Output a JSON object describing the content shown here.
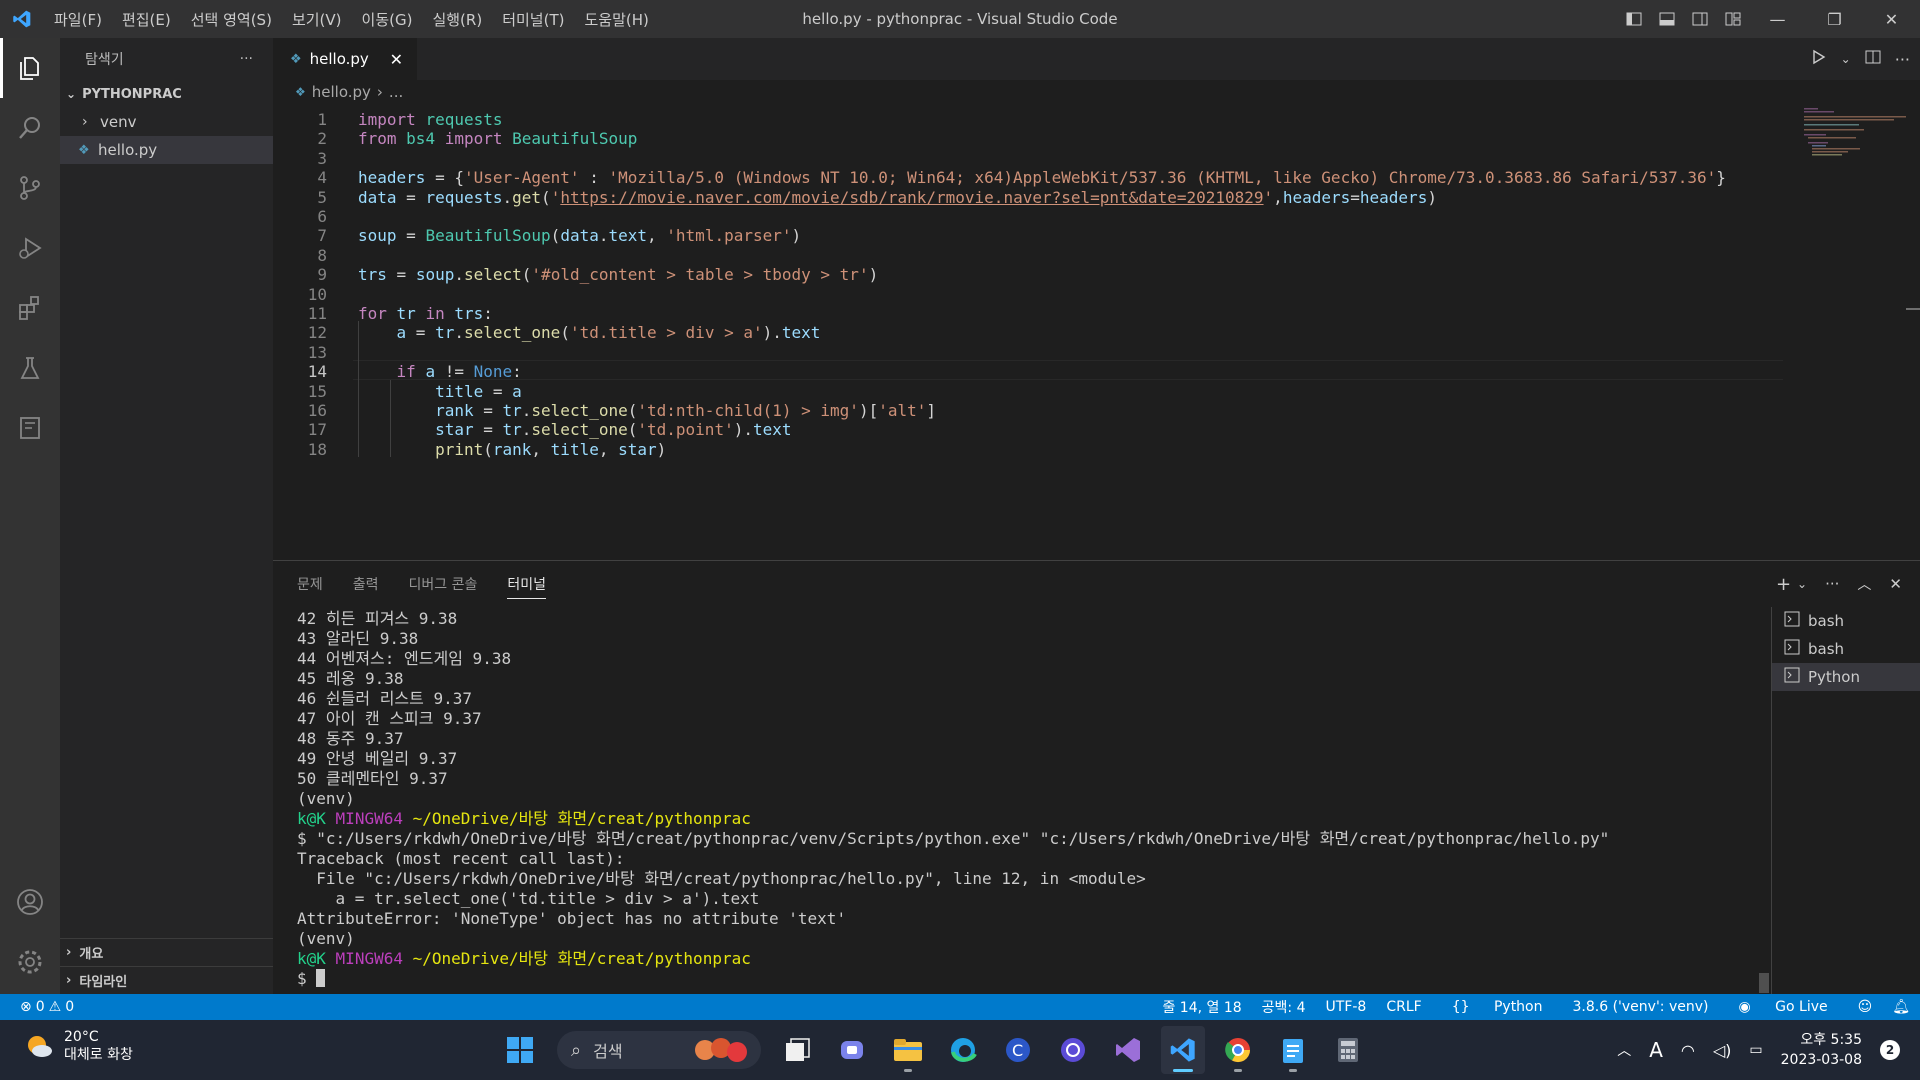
{
  "titlebar": {
    "menu": [
      "파일(F)",
      "편집(E)",
      "선택 영역(S)",
      "보기(V)",
      "이동(G)",
      "실행(R)",
      "터미널(T)",
      "도움말(H)"
    ],
    "window_title": "hello.py - pythonprac - Visual Studio Code"
  },
  "sidebar": {
    "header": "탐색기",
    "more": "···",
    "folder": "PYTHONPRAC",
    "items": [
      "venv",
      "hello.py"
    ],
    "bottom": [
      "개요",
      "타임라인"
    ]
  },
  "editor": {
    "tab_label": "hello.py",
    "breadcrumb": [
      "hello.py",
      "..."
    ],
    "current_line": 14,
    "lines": [
      {
        "n": "1",
        "tokens": [
          [
            "kw",
            "import"
          ],
          [
            "op",
            " "
          ],
          [
            "cl",
            "requests"
          ]
        ]
      },
      {
        "n": "2",
        "tokens": [
          [
            "kw",
            "from"
          ],
          [
            "op",
            " "
          ],
          [
            "cl",
            "bs4"
          ],
          [
            "op",
            " "
          ],
          [
            "kw",
            "import"
          ],
          [
            "op",
            " "
          ],
          [
            "cl",
            "BeautifulSoup"
          ]
        ]
      },
      {
        "n": "3",
        "tokens": []
      },
      {
        "n": "4",
        "tokens": [
          [
            "va",
            "headers"
          ],
          [
            "op",
            " = {"
          ],
          [
            "st",
            "'User-Agent'"
          ],
          [
            "op",
            " : "
          ],
          [
            "st",
            "'Mozilla/5.0 (Windows NT 10.0; Win64; x64)AppleWebKit/537.36 (KHTML, like Gecko) Chrome/73.0.3683.86 Safari/537.36'"
          ],
          [
            "op",
            "}"
          ]
        ]
      },
      {
        "n": "5",
        "tokens": [
          [
            "va",
            "data"
          ],
          [
            "op",
            " = "
          ],
          [
            "va",
            "requests"
          ],
          [
            "op",
            "."
          ],
          [
            "fn",
            "get"
          ],
          [
            "op",
            "("
          ],
          [
            "st",
            "'"
          ],
          [
            "url",
            "https://movie.naver.com/movie/sdb/rank/rmovie.naver?sel=pnt&date=20210829"
          ],
          [
            "st",
            "'"
          ],
          [
            "op",
            ","
          ],
          [
            "va",
            "headers"
          ],
          [
            "op",
            "="
          ],
          [
            "va",
            "headers"
          ],
          [
            "op",
            ")"
          ]
        ]
      },
      {
        "n": "6",
        "tokens": []
      },
      {
        "n": "7",
        "tokens": [
          [
            "va",
            "soup"
          ],
          [
            "op",
            " = "
          ],
          [
            "cl",
            "BeautifulSoup"
          ],
          [
            "op",
            "("
          ],
          [
            "va",
            "data"
          ],
          [
            "op",
            "."
          ],
          [
            "va",
            "text"
          ],
          [
            "op",
            ", "
          ],
          [
            "st",
            "'html.parser'"
          ],
          [
            "op",
            ")"
          ]
        ]
      },
      {
        "n": "8",
        "tokens": []
      },
      {
        "n": "9",
        "tokens": [
          [
            "va",
            "trs"
          ],
          [
            "op",
            " = "
          ],
          [
            "va",
            "soup"
          ],
          [
            "op",
            "."
          ],
          [
            "fn",
            "select"
          ],
          [
            "op",
            "("
          ],
          [
            "st",
            "'#old_content > table > tbody > tr'"
          ],
          [
            "op",
            ")"
          ]
        ]
      },
      {
        "n": "10",
        "tokens": []
      },
      {
        "n": "11",
        "tokens": [
          [
            "kw",
            "for"
          ],
          [
            "op",
            " "
          ],
          [
            "va",
            "tr"
          ],
          [
            "op",
            " "
          ],
          [
            "kw",
            "in"
          ],
          [
            "op",
            " "
          ],
          [
            "va",
            "trs"
          ],
          [
            "op",
            ":"
          ]
        ]
      },
      {
        "n": "12",
        "tokens": [
          [
            "op",
            "    "
          ],
          [
            "va",
            "a"
          ],
          [
            "op",
            " = "
          ],
          [
            "va",
            "tr"
          ],
          [
            "op",
            "."
          ],
          [
            "fn",
            "select_one"
          ],
          [
            "op",
            "("
          ],
          [
            "st",
            "'td.title > div > a'"
          ],
          [
            "op",
            ")."
          ],
          [
            "va",
            "text"
          ]
        ]
      },
      {
        "n": "13",
        "tokens": []
      },
      {
        "n": "14",
        "tokens": [
          [
            "op",
            "    "
          ],
          [
            "kw",
            "if"
          ],
          [
            "op",
            " "
          ],
          [
            "va",
            "a"
          ],
          [
            "op",
            " != "
          ],
          [
            "bi",
            "None"
          ],
          [
            "op",
            ":"
          ]
        ]
      },
      {
        "n": "15",
        "tokens": [
          [
            "op",
            "        "
          ],
          [
            "va",
            "title"
          ],
          [
            "op",
            " = "
          ],
          [
            "va",
            "a"
          ]
        ]
      },
      {
        "n": "16",
        "tokens": [
          [
            "op",
            "        "
          ],
          [
            "va",
            "rank"
          ],
          [
            "op",
            " = "
          ],
          [
            "va",
            "tr"
          ],
          [
            "op",
            "."
          ],
          [
            "fn",
            "select_one"
          ],
          [
            "op",
            "("
          ],
          [
            "st",
            "'td:nth-child(1) > img'"
          ],
          [
            "op",
            ")["
          ],
          [
            "st",
            "'alt'"
          ],
          [
            "op",
            "]"
          ]
        ]
      },
      {
        "n": "17",
        "tokens": [
          [
            "op",
            "        "
          ],
          [
            "va",
            "star"
          ],
          [
            "op",
            " = "
          ],
          [
            "va",
            "tr"
          ],
          [
            "op",
            "."
          ],
          [
            "fn",
            "select_one"
          ],
          [
            "op",
            "("
          ],
          [
            "st",
            "'td.point'"
          ],
          [
            "op",
            ")."
          ],
          [
            "va",
            "text"
          ]
        ]
      },
      {
        "n": "18",
        "tokens": [
          [
            "op",
            "        "
          ],
          [
            "fn",
            "print"
          ],
          [
            "op",
            "("
          ],
          [
            "va",
            "rank"
          ],
          [
            "op",
            ", "
          ],
          [
            "va",
            "title"
          ],
          [
            "op",
            ", "
          ],
          [
            "va",
            "star"
          ],
          [
            "op",
            ")"
          ]
        ]
      }
    ]
  },
  "panel": {
    "tabs": [
      "문제",
      "출력",
      "디버그 콘솔",
      "터미널"
    ],
    "active_tab": "터미널",
    "terminals": [
      "bash",
      "bash",
      "Python"
    ],
    "terminal_lines": [
      [
        [
          "",
          "42 히든 피겨스 9.38"
        ]
      ],
      [
        [
          "",
          "43 알라딘 9.38"
        ]
      ],
      [
        [
          "",
          "44 어벤져스: 엔드게임 9.38"
        ]
      ],
      [
        [
          "",
          "45 레옹 9.38"
        ]
      ],
      [
        [
          "",
          "46 쉰들러 리스트 9.37"
        ]
      ],
      [
        [
          "",
          "47 아이 캔 스피크 9.37"
        ]
      ],
      [
        [
          "",
          "48 동주 9.37"
        ]
      ],
      [
        [
          "",
          "49 안녕 베일리 9.37"
        ]
      ],
      [
        [
          "",
          "50 클레멘타인 9.37"
        ]
      ],
      [
        [
          "",
          "(venv)"
        ]
      ],
      [
        [
          "g",
          "k@K"
        ],
        [
          "",
          " "
        ],
        [
          "p",
          "MINGW64"
        ],
        [
          "",
          " "
        ],
        [
          "y",
          "~/OneDrive/바탕 화면/creat/pythonprac"
        ]
      ],
      [
        [
          "",
          "$ \"c:/Users/rkdwh/OneDrive/바탕 화면/creat/pythonprac/venv/Scripts/python.exe\" \"c:/Users/rkdwh/OneDrive/바탕 화면/creat/pythonprac/hello.py\""
        ]
      ],
      [
        [
          "",
          "Traceback (most recent call last):"
        ]
      ],
      [
        [
          "",
          "  File \"c:/Users/rkdwh/OneDrive/바탕 화면/creat/pythonprac/hello.py\", line 12, in <module>"
        ]
      ],
      [
        [
          "",
          "    a = tr.select_one('td.title > div > a').text"
        ]
      ],
      [
        [
          "",
          "AttributeError: 'NoneType' object has no attribute 'text'"
        ]
      ],
      [
        [
          "",
          "(venv)"
        ]
      ],
      [
        [
          "g",
          "k@K"
        ],
        [
          "",
          " "
        ],
        [
          "p",
          "MINGW64"
        ],
        [
          "",
          " "
        ],
        [
          "y",
          "~/OneDrive/바탕 화면/creat/pythonprac"
        ]
      ]
    ],
    "prompt": "$ "
  },
  "statusbar": {
    "errors": "0",
    "warnings": "0",
    "position": "줄 14, 열 18",
    "spaces": "공백: 4",
    "encoding": "UTF-8",
    "eol": "CRLF",
    "language": "Python",
    "interpreter": "3.8.6 ('venv': venv)",
    "golive": "Go Live"
  },
  "taskbar": {
    "temp": "20°C",
    "weather": "대체로 화창",
    "search_placeholder": "검색",
    "time": "오후 5:35",
    "date": "2023-03-08",
    "notifications": "2"
  },
  "colors": {
    "accent": "#007acc",
    "titlebar": "#323233",
    "editor_bg": "#1e1e1e"
  }
}
